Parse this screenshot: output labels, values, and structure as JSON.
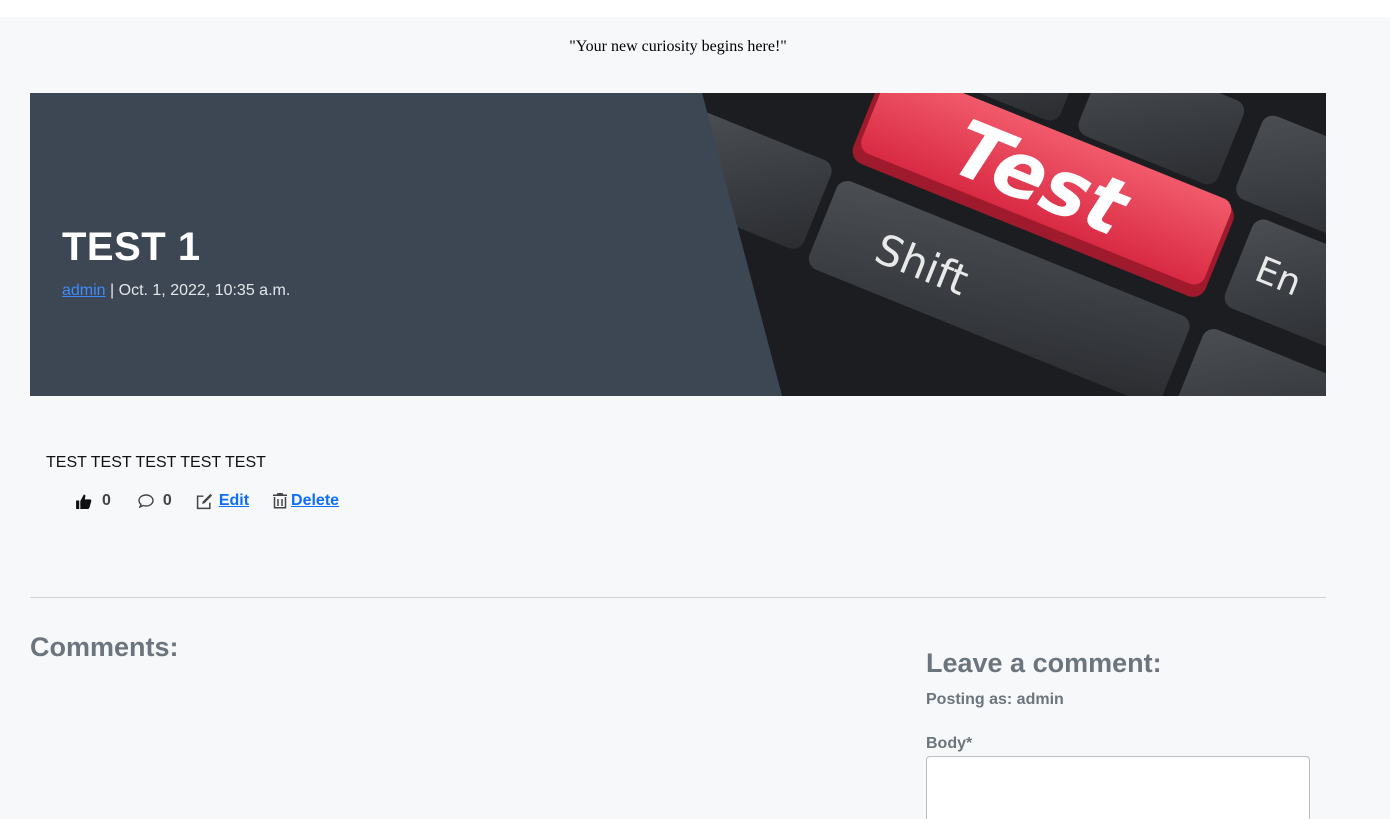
{
  "header": {
    "tagline": "\"Your new curiosity begins here!\""
  },
  "post": {
    "title": "TEST 1",
    "author": "admin",
    "separator": " | ",
    "date": "Oct. 1, 2022, 10:35 a.m.",
    "image_key_text": "Test",
    "image_shift_text": "Shift",
    "image_enter_text": "En",
    "body": "TEST TEST TEST TEST TEST",
    "likes": "0",
    "comment_count": "0",
    "edit_label": "Edit",
    "delete_label": "Delete"
  },
  "comments": {
    "title": "Comments:",
    "leave_title": "Leave a comment:",
    "posting_as": "Posting as: admin",
    "body_label": "Body*",
    "body_value": ""
  },
  "colors": {
    "page_bg": "#f7f8fa",
    "hero_bg": "#3d4753",
    "link": "#0d6efd",
    "key_red": "#e8384f",
    "muted_text": "#6c757d"
  },
  "icons": [
    "thumbs-up-icon",
    "comment-icon",
    "edit-icon",
    "trash-icon"
  ]
}
